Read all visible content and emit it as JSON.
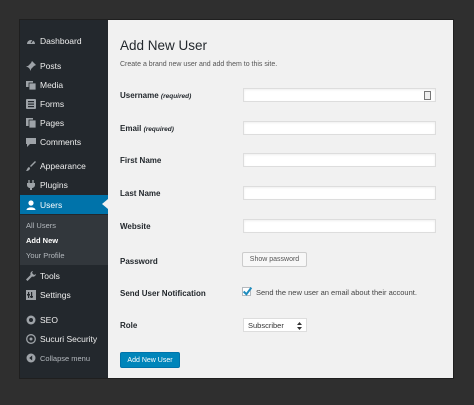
{
  "sidebar": {
    "items": [
      {
        "label": "Dashboard",
        "icon": "dashboard-icon"
      },
      {
        "label": "Posts",
        "icon": "pin-icon"
      },
      {
        "label": "Media",
        "icon": "media-icon"
      },
      {
        "label": "Forms",
        "icon": "forms-icon"
      },
      {
        "label": "Pages",
        "icon": "pages-icon"
      },
      {
        "label": "Comments",
        "icon": "comments-icon"
      },
      {
        "label": "Appearance",
        "icon": "brush-icon"
      },
      {
        "label": "Plugins",
        "icon": "plugin-icon"
      },
      {
        "label": "Users",
        "icon": "user-icon"
      },
      {
        "label": "Tools",
        "icon": "wrench-icon"
      },
      {
        "label": "Settings",
        "icon": "settings-icon"
      },
      {
        "label": "SEO",
        "icon": "seo-icon"
      },
      {
        "label": "Sucuri Security",
        "icon": "shield-icon"
      },
      {
        "label": "Collapse menu",
        "icon": "collapse-icon"
      }
    ],
    "submenu": [
      "All Users",
      "Add New",
      "Your Profile"
    ],
    "active": "Users",
    "current_sub": "Add New",
    "accent_color": "#0073aa"
  },
  "page": {
    "title": "Add New User",
    "description": "Create a brand new user and add them to this site."
  },
  "form": {
    "username": {
      "label": "Username",
      "required": "(required)",
      "value": ""
    },
    "email": {
      "label": "Email",
      "required": "(required)",
      "value": ""
    },
    "first_name": {
      "label": "First Name",
      "value": ""
    },
    "last_name": {
      "label": "Last Name",
      "value": ""
    },
    "website": {
      "label": "Website",
      "value": ""
    },
    "password": {
      "label": "Password",
      "button": "Show password"
    },
    "notification": {
      "label": "Send User Notification",
      "text": "Send the new user an email about their account.",
      "checked": true
    },
    "role": {
      "label": "Role",
      "value": "Subscriber"
    },
    "submit": "Add New User"
  }
}
